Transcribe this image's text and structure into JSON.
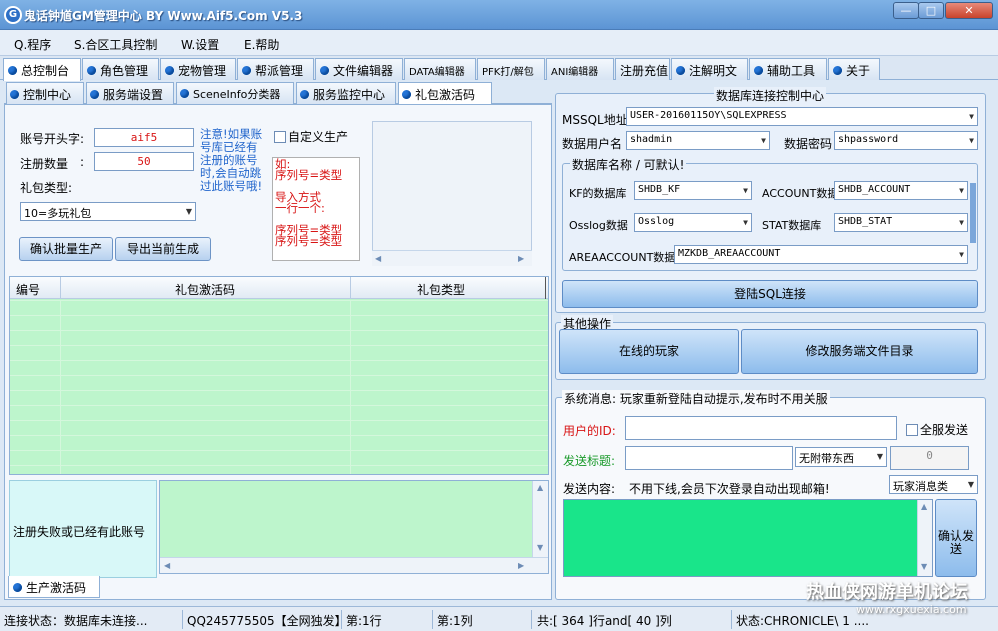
{
  "window": {
    "title": "鬼话钟馗GM管理中心 BY Www.Aif5.Com  V5.3",
    "min": "0",
    "max": "1",
    "close": "r"
  },
  "menu": [
    "Q.程序",
    "S.合区工具控制",
    "W.设置",
    "E.帮助"
  ],
  "main_tabs": [
    "总控制台",
    "角色管理",
    "宠物管理",
    "帮派管理",
    "文件编辑器",
    "DATA编辑器",
    "PFK打/解包",
    "ANI编辑器",
    "注册充值",
    "注解明文",
    "辅助工具",
    "关于"
  ],
  "sub_tabs": [
    "控制中心",
    "服务端设置",
    "SceneInfo分类器",
    "服务监控中心",
    "礼包激活码"
  ],
  "gift": {
    "prefix_label": "账号开头字:",
    "prefix_value": "aif5",
    "count_label": "注册数量",
    "count_colon": ":",
    "count_value": "50",
    "type_label": "礼包类型:",
    "type_value": "10=多玩礼包",
    "notice": "注意!如果账号库已经有注册的账号时,会自动跳过此账号哦!",
    "custom_label": "自定义生产",
    "btn_confirm": "确认批量生产",
    "btn_export": "导出当前生成",
    "example": [
      "如:",
      "序列号=类型",
      "",
      "导入方式",
      "一行一个:",
      "",
      "序列号=类型",
      "序列号=类型"
    ],
    "table_headers": [
      "编号",
      "礼包激活码",
      "礼包类型"
    ],
    "fail_label": "注册失败或已经有此账号",
    "bottom_tab": "生产激活码"
  },
  "db": {
    "group_title": "数据库连接控制中心",
    "mssql_label": "MSSQL地址:",
    "mssql_value": "USER-20160115OY\\SQLEXPRESS",
    "user_label": "数据用户名",
    "user_value": "shadmin",
    "pwd_label": "数据密码",
    "pwd_value": "shpassword",
    "names_title": "数据库名称 / 可默认!",
    "kf_label": "KF的数据库",
    "kf_value": "SHDB_KF",
    "account_label": "ACCOUNT数据",
    "account_value": "SHDB_ACCOUNT",
    "osslog_label": "Osslog数据",
    "osslog_value": "Osslog",
    "stat_label": "STAT数据库",
    "stat_value": "SHDB_STAT",
    "area_label": "AREAACCOUNT数据库",
    "area_value": "MZKDB_AREAACCOUNT",
    "login_btn": "登陆SQL连接"
  },
  "other": {
    "title": "其他操作",
    "online_btn": "在线的玩家",
    "modify_btn": "修改服务端文件目录"
  },
  "sysmsg": {
    "title": "系统消息: 玩家重新登陆自动提示,发布时不用关服",
    "userid_label": "用户的ID:",
    "userid_value": "",
    "allsend_label": "全服发送",
    "subject_label": "发送标题:",
    "subject_value": "",
    "attach_value": "无附带东西",
    "qty_value": "0",
    "content_label": "发送内容:",
    "content_hint": "不用下线,会员下次登录自动出现邮箱!",
    "msgtype_value": "玩家消息类",
    "send_btn": "确认发送"
  },
  "status": {
    "conn": "连接状态：数据库未连接...",
    "qq": "QQ245775505【全网独发】",
    "row": "第:1行",
    "col": "第:1列",
    "total": "共:[ 364 ]行and[ 40 ]列",
    "state": "状态:CHRONICLE\\ 1 ...."
  },
  "watermark": {
    "line1": "热血侠网游单机论坛",
    "line2": "www.rxgxuexia.com"
  },
  "colors": {
    "accent": "#2474d6",
    "list_bg": "#bdf5cc",
    "msg_bg": "#19e58a",
    "red_text": "#d81414"
  }
}
